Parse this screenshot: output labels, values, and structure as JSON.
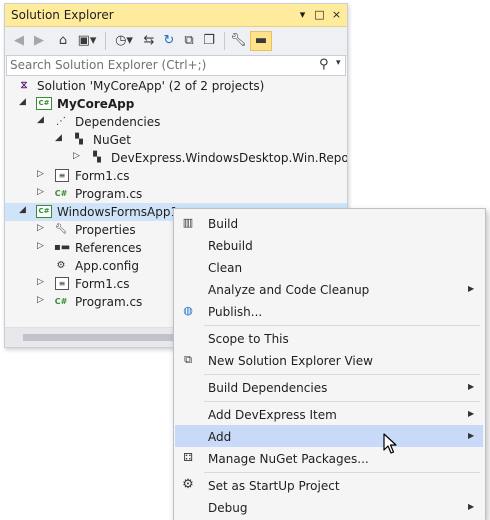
{
  "explorer": {
    "title": "Solution Explorer",
    "title_buttons": [
      "▾",
      "□",
      "×"
    ],
    "search": {
      "placeholder": "Search Solution Explorer (Ctrl+;)",
      "value": ""
    },
    "tree": [
      {
        "label": "Solution 'MyCoreApp' (2 of 2 projects)",
        "icon": "solution-icon",
        "bold": false,
        "selected": false
      },
      {
        "label": "MyCoreApp",
        "icon": "csharp-project-icon",
        "bold": true,
        "selected": false
      },
      {
        "label": "Dependencies",
        "icon": "dependencies-icon",
        "bold": false,
        "selected": false
      },
      {
        "label": "NuGet",
        "icon": "nuget-icon",
        "bold": false,
        "selected": false
      },
      {
        "label": "DevExpress.WindowsDesktop.Win.Reporting",
        "icon": "package-icon",
        "bold": false,
        "selected": false
      },
      {
        "label": "Form1.cs",
        "icon": "form-icon",
        "bold": false,
        "selected": false
      },
      {
        "label": "Program.cs",
        "icon": "csharp-file-icon",
        "bold": false,
        "selected": false
      },
      {
        "label": "WindowsFormsApp1",
        "icon": "csharp-project-icon",
        "bold": false,
        "selected": true
      },
      {
        "label": "Properties",
        "icon": "wrench-icon",
        "bold": false,
        "selected": false
      },
      {
        "label": "References",
        "icon": "references-icon",
        "bold": false,
        "selected": false
      },
      {
        "label": "App.config",
        "icon": "config-icon",
        "bold": false,
        "selected": false
      },
      {
        "label": "Form1.cs",
        "icon": "form-icon",
        "bold": false,
        "selected": false
      },
      {
        "label": "Program.cs",
        "icon": "csharp-file-icon",
        "bold": false,
        "selected": false
      }
    ]
  },
  "context_menu": {
    "items": [
      {
        "label": "Build",
        "icon": "build-icon",
        "submenu": false
      },
      {
        "label": "Rebuild",
        "icon": "",
        "submenu": false
      },
      {
        "label": "Clean",
        "icon": "",
        "submenu": false
      },
      {
        "label": "Analyze and Code Cleanup",
        "icon": "",
        "submenu": true
      },
      {
        "label": "Publish...",
        "icon": "globe-icon",
        "submenu": false
      },
      {
        "label": "Scope to This",
        "icon": "",
        "submenu": false
      },
      {
        "label": "New Solution Explorer View",
        "icon": "new-view-icon",
        "submenu": false
      },
      {
        "label": "Build Dependencies",
        "icon": "",
        "submenu": true
      },
      {
        "label": "Add DevExpress Item",
        "icon": "",
        "submenu": true
      },
      {
        "label": "Add",
        "icon": "",
        "submenu": true,
        "highlighted": true
      },
      {
        "label": "Manage NuGet Packages...",
        "icon": "nuget-manage-icon",
        "submenu": false
      },
      {
        "label": "Set as StartUp Project",
        "icon": "gear-icon",
        "submenu": false
      },
      {
        "label": "Debug",
        "icon": "",
        "submenu": true
      }
    ]
  },
  "colors": {
    "title_bar": "#ffeb9c",
    "selection": "#cfe4f8",
    "menu_highlight": "#c9daf8",
    "csharp_green": "#388a34",
    "vs_purple": "#68217a"
  }
}
